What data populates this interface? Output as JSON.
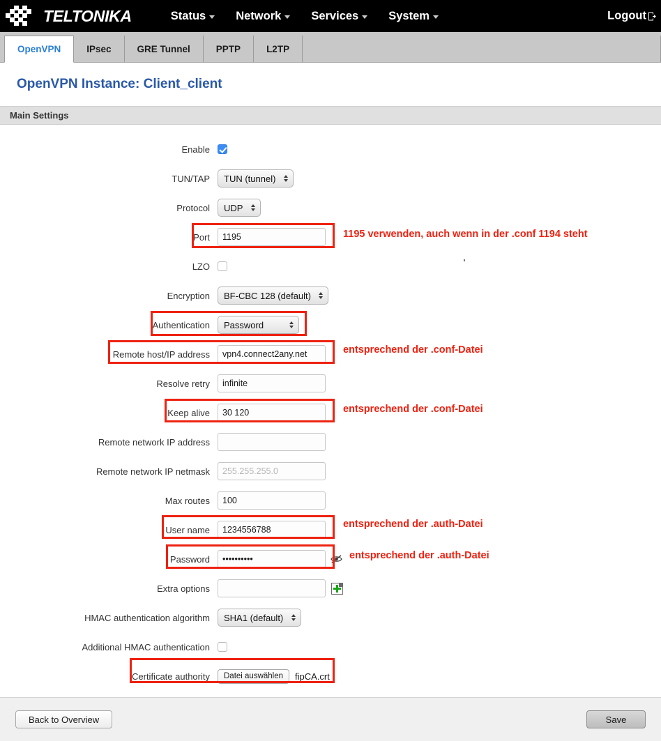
{
  "header": {
    "brand": "TELTONIKA",
    "nav": [
      {
        "label": "Status"
      },
      {
        "label": "Network"
      },
      {
        "label": "Services"
      },
      {
        "label": "System"
      }
    ],
    "logout_label": "Logout"
  },
  "tabs": [
    {
      "label": "OpenVPN",
      "active": true
    },
    {
      "label": "IPsec",
      "active": false
    },
    {
      "label": "GRE Tunnel",
      "active": false
    },
    {
      "label": "PPTP",
      "active": false
    },
    {
      "label": "L2TP",
      "active": false
    }
  ],
  "page": {
    "title": "OpenVPN Instance: Client_client",
    "section_title": "Main Settings"
  },
  "fields": {
    "enable": {
      "label": "Enable",
      "checked": true
    },
    "tuntap": {
      "label": "TUN/TAP",
      "value": "TUN (tunnel)"
    },
    "protocol": {
      "label": "Protocol",
      "value": "UDP"
    },
    "port": {
      "label": "Port",
      "value": "1195"
    },
    "lzo": {
      "label": "LZO",
      "checked": false
    },
    "encryption": {
      "label": "Encryption",
      "value": "BF-CBC 128 (default)"
    },
    "authentication": {
      "label": "Authentication",
      "value": "Password"
    },
    "remote_host": {
      "label": "Remote host/IP address",
      "value": "vpn4.connect2any.net"
    },
    "resolve_retry": {
      "label": "Resolve retry",
      "value": "infinite"
    },
    "keep_alive": {
      "label": "Keep alive",
      "value": "30 120"
    },
    "remote_net_ip": {
      "label": "Remote network IP address",
      "value": ""
    },
    "remote_net_mask": {
      "label": "Remote network IP netmask",
      "value": "",
      "placeholder": "255.255.255.0"
    },
    "max_routes": {
      "label": "Max routes",
      "value": "100"
    },
    "user_name": {
      "label": "User name",
      "value": "1234556788"
    },
    "password": {
      "label": "Password",
      "value": "••••••••••"
    },
    "extra_options": {
      "label": "Extra options",
      "value": ""
    },
    "hmac_algorithm": {
      "label": "HMAC authentication algorithm",
      "value": "SHA1 (default)"
    },
    "additional_hmac": {
      "label": "Additional HMAC authentication",
      "checked": false
    },
    "certificate_authority": {
      "label": "Certificate authority",
      "button_label": "Datei auswählen",
      "filename": "fipCA.crt"
    }
  },
  "annotations": [
    {
      "text": "1195 verwenden, auch wenn in der .conf 1194 steht"
    },
    {
      "text": "entsprechend der .conf-Datei"
    },
    {
      "text": "entsprechend der .conf-Datei"
    },
    {
      "text": "entsprechend der .auth-Datei"
    },
    {
      "text": "entsprechend der .auth-Datei"
    }
  ],
  "footer": {
    "back_label": "Back to Overview",
    "save_label": "Save"
  },
  "colors": {
    "accent_blue": "#2958a8",
    "tab_blue": "#2a7fd4",
    "annotation_red": "#ee2211",
    "checkbox_blue": "#3b8cf5"
  }
}
